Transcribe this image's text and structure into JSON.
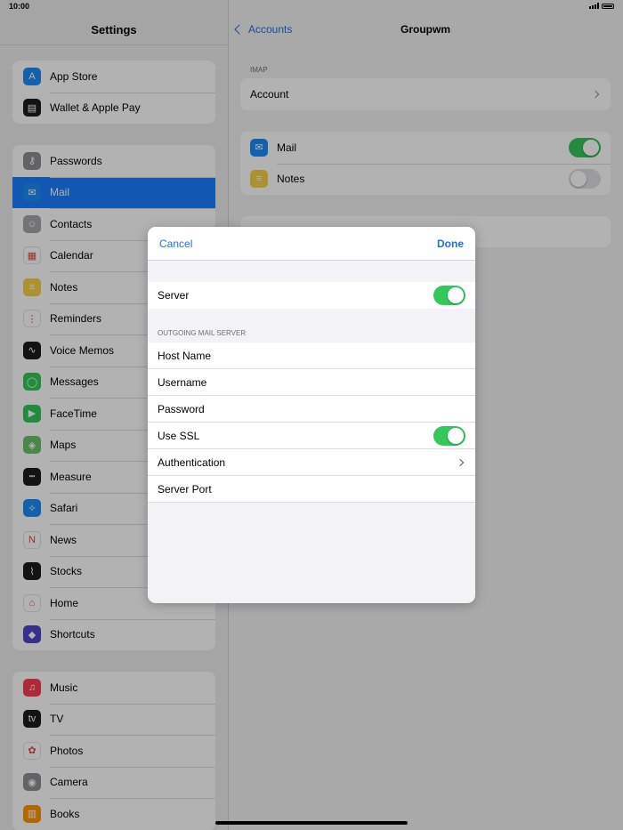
{
  "status": {
    "time": "10:00"
  },
  "sidebar": {
    "title": "Settings",
    "group1": [
      {
        "label": "App Store",
        "icon": "app-store-icon",
        "color": "#1c8cf2",
        "glyph": "A"
      },
      {
        "label": "Wallet & Apple Pay",
        "icon": "wallet-icon",
        "color": "#1c1c1e",
        "glyph": "▤"
      }
    ],
    "group2": [
      {
        "label": "Passwords",
        "icon": "key-icon",
        "color": "#8e8e93",
        "glyph": "⚷"
      },
      {
        "label": "Mail",
        "icon": "mail-icon",
        "color": "#1e8bf5",
        "glyph": "✉",
        "selected": true
      },
      {
        "label": "Contacts",
        "icon": "contacts-icon",
        "color": "#a5a5aa",
        "glyph": "☺"
      },
      {
        "label": "Calendar",
        "icon": "calendar-icon",
        "color": "#ffffff",
        "glyph": "▦"
      },
      {
        "label": "Notes",
        "icon": "notes-icon",
        "color": "#f7d04a",
        "glyph": "≡"
      },
      {
        "label": "Reminders",
        "icon": "reminders-icon",
        "color": "#ffffff",
        "glyph": "⋮"
      },
      {
        "label": "Voice Memos",
        "icon": "voice-memos-icon",
        "color": "#1c1c1e",
        "glyph": "∿"
      },
      {
        "label": "Messages",
        "icon": "messages-icon",
        "color": "#34c759",
        "glyph": "◯"
      },
      {
        "label": "FaceTime",
        "icon": "facetime-icon",
        "color": "#34c759",
        "glyph": "▶"
      },
      {
        "label": "Maps",
        "icon": "maps-icon",
        "color": "#6fc06b",
        "glyph": "◈"
      },
      {
        "label": "Measure",
        "icon": "measure-icon",
        "color": "#1c1c1e",
        "glyph": "┅"
      },
      {
        "label": "Safari",
        "icon": "safari-icon",
        "color": "#1e8bf5",
        "glyph": "✧"
      },
      {
        "label": "News",
        "icon": "news-icon",
        "color": "#ffffff",
        "glyph": "N"
      },
      {
        "label": "Stocks",
        "icon": "stocks-icon",
        "color": "#1c1c1e",
        "glyph": "⌇"
      },
      {
        "label": "Home",
        "icon": "home-icon",
        "color": "#ffffff",
        "glyph": "⌂"
      },
      {
        "label": "Shortcuts",
        "icon": "shortcuts-icon",
        "color": "#4b46c8",
        "glyph": "◆"
      }
    ],
    "group3": [
      {
        "label": "Music",
        "icon": "music-icon",
        "color": "#fb3c52",
        "glyph": "♫"
      },
      {
        "label": "TV",
        "icon": "tv-icon",
        "color": "#1c1c1e",
        "glyph": "tv"
      },
      {
        "label": "Photos",
        "icon": "photos-icon",
        "color": "#ffffff",
        "glyph": "✿"
      },
      {
        "label": "Camera",
        "icon": "camera-icon",
        "color": "#8e8e93",
        "glyph": "◉"
      },
      {
        "label": "Books",
        "icon": "books-icon",
        "color": "#ff9500",
        "glyph": "▥"
      }
    ]
  },
  "detail": {
    "back_label": "Accounts",
    "title": "Groupwm",
    "section_label": "IMAP",
    "account_label": "Account",
    "mail_label": "Mail",
    "notes_label": "Notes"
  },
  "modal": {
    "cancel_label": "Cancel",
    "done_label": "Done",
    "server_label": "Server",
    "section_label": "OUTGOING MAIL SERVER",
    "host_label": "Host Name",
    "username_label": "Username",
    "password_label": "Password",
    "ssl_label": "Use SSL",
    "auth_label": "Authentication",
    "port_label": "Server Port"
  }
}
